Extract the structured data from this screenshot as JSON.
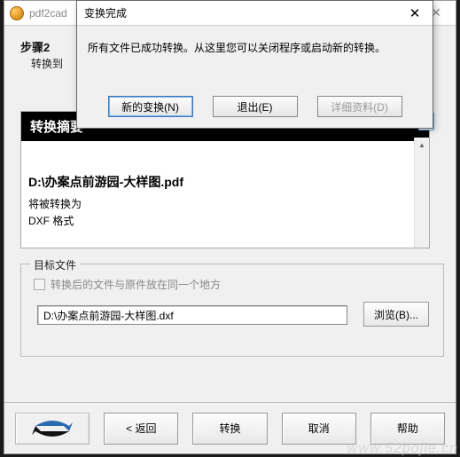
{
  "main": {
    "title": "pdf2cad",
    "step_label": "步骤2",
    "step_sub": "转换到",
    "summary_header": "转换摘要",
    "file_path": "D:\\办案点前游园-大样图.pdf",
    "will_convert": "将被转换为",
    "format": "DXF 格式"
  },
  "target": {
    "legend": "目标文件",
    "checkbox_label": "转换后的文件与原件放在同一个地方",
    "path_value": "D:\\办案点前游园-大样图.dxf",
    "browse_label": "浏览(B)..."
  },
  "bottom": {
    "back": "< 返回",
    "convert": "转换",
    "cancel": "取消",
    "help": "帮助"
  },
  "modal": {
    "title": "变换完成",
    "message": "所有文件已成功转换。从这里您可以关闭程序或启动新的转换。",
    "new_btn": "新的变换(N)",
    "exit_btn": "退出(E)",
    "detail_btn": "详细资料(D)"
  },
  "watermark": "www.52pojie.cn"
}
